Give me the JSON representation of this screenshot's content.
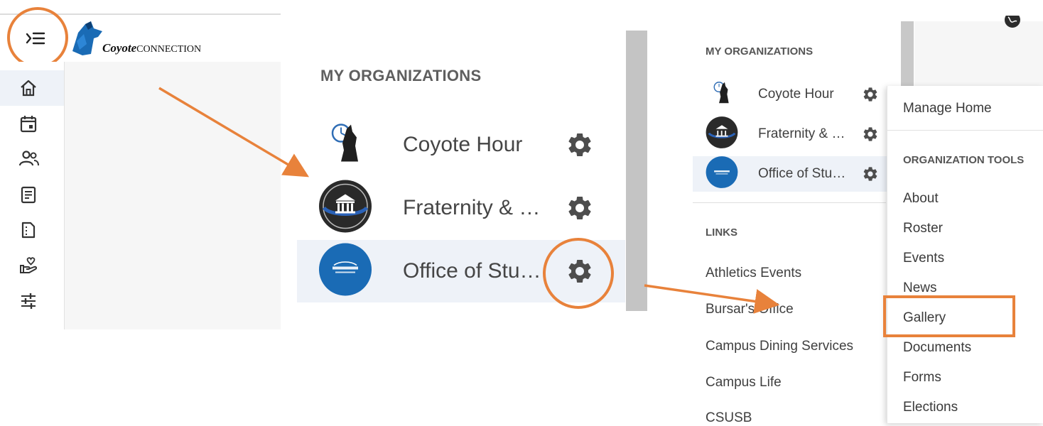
{
  "app": {
    "logo_script": "Coyote",
    "logo_caps": "CONNECTION"
  },
  "nav_rail": [
    {
      "icon": "home-icon",
      "active": true
    },
    {
      "icon": "calendar-icon"
    },
    {
      "icon": "people-icon"
    },
    {
      "icon": "news-icon"
    },
    {
      "icon": "documents-icon"
    },
    {
      "icon": "service-hand-heart-icon"
    },
    {
      "icon": "sliders-icon"
    }
  ],
  "zoomed": {
    "title": "MY ORGANIZATIONS",
    "orgs": [
      {
        "name": "Coyote Hour",
        "avatar": "coyote-clock-avatar"
      },
      {
        "name": "Fraternity & …",
        "avatar": "greek-building-avatar"
      },
      {
        "name": "Office of Stu…",
        "avatar": "blue-seal-avatar",
        "selected": true
      }
    ]
  },
  "sidebar": {
    "orgs_title": "MY ORGANIZATIONS",
    "orgs": [
      {
        "name": "Coyote Hour"
      },
      {
        "name": "Fraternity & …"
      },
      {
        "name": "Office of Stu…",
        "selected": true
      }
    ],
    "links_title": "LINKS",
    "links": [
      "Athletics Events",
      "Bursar's Office",
      "Campus Dining Services",
      "Campus Life",
      "CSUSB"
    ]
  },
  "dropdown": {
    "manage": "Manage Home",
    "tools_title": "ORGANIZATION TOOLS",
    "items": [
      "About",
      "Roster",
      "Events",
      "News",
      "Gallery",
      "Documents",
      "Forms",
      "Elections"
    ],
    "highlighted": "Gallery"
  },
  "colors": {
    "callout": "#e8823b",
    "selected_row": "#eef2f8",
    "brand_blue": "#1a6bb5"
  }
}
